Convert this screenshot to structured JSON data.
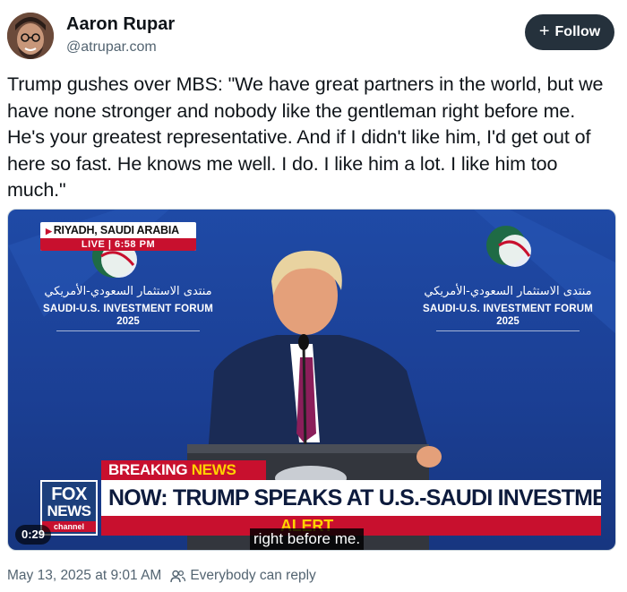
{
  "author": {
    "name": "Aaron Rupar",
    "handle": "@atrupar.com"
  },
  "follow_button": {
    "label": "Follow",
    "icon": "plus-icon"
  },
  "post": {
    "text": "Trump gushes over MBS: \"We have great partners in the world, but we have none stronger and nobody like the gentleman right before me. He's your greatest representative. And if I didn't like him, I'd get out of here so fast. He knows me well. I do. I like him a lot. I like him too much.\""
  },
  "video": {
    "location_label": "RIYADH, SAUDI ARABIA",
    "live_label": "LIVE | 6:58 PM",
    "forum_arabic": "منتدى الاستثمار السعودي-الأمريكي",
    "forum_english": "SAUDI-U.S. INVESTMENT FORUM",
    "forum_year": "2025",
    "breaking_label_1": "BREAKING ",
    "breaking_label_2": "NEWS",
    "headline": "NOW: TRUMP SPEAKS AT U.S.-SAUDI INVESTMENT FORUM",
    "alert_text": "ALERT",
    "network_logo_1": "FOX",
    "network_logo_2": "NEWS",
    "network_logo_3": "channel",
    "caption": "right before me.",
    "timestamp": "0:29"
  },
  "footer": {
    "date": "May 13, 2025 at 9:01 AM",
    "reply_setting": "Everybody can reply",
    "reply_icon": "people-icon"
  },
  "colors": {
    "follow_bg": "#25313c",
    "fox_red": "#c8102e",
    "fox_yellow": "#ffd200",
    "stage_blue": "#1f4aa6",
    "muted_text": "#536471"
  }
}
